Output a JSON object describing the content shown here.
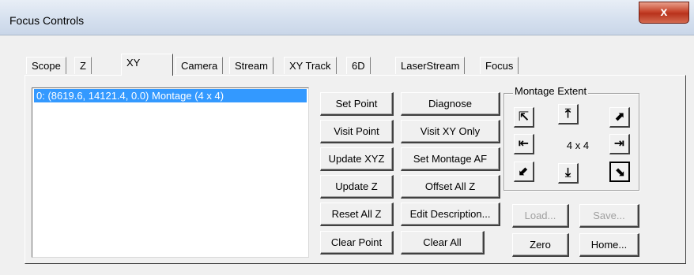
{
  "window": {
    "title": "Focus Controls",
    "close_glyph": "x"
  },
  "tabs": [
    {
      "label": "Scope"
    },
    {
      "label": "Z"
    },
    {
      "label": "XY"
    },
    {
      "label": "Camera"
    },
    {
      "label": "Stream"
    },
    {
      "label": "XY Track"
    },
    {
      "label": "6D"
    },
    {
      "label": "LaserStream"
    },
    {
      "label": "Focus"
    }
  ],
  "active_tab": "XY",
  "points_list": {
    "items": [
      {
        "text": "0: (8619.6, 14121.4, 0.0) Montage  (4 x 4)",
        "selected": true
      }
    ]
  },
  "buttons": {
    "set_point": "Set Point",
    "diagnose": "Diagnose",
    "visit_point": "Visit Point",
    "visit_xy_only": "Visit XY Only",
    "update_xyz": "Update XYZ",
    "set_montage_af": "Set Montage AF",
    "update_z": "Update Z",
    "offset_all_z": "Offset All Z",
    "reset_all_z": "Reset All Z",
    "edit_description": "Edit Description...",
    "clear_point": "Clear Point",
    "clear_all": "Clear All",
    "load": "Load...",
    "save": "Save...",
    "zero": "Zero",
    "home": "Home..."
  },
  "montage_extent": {
    "label": "Montage Extent",
    "value": "4 x 4",
    "arrows": {
      "up_left": "⇱",
      "up": "⤒",
      "up_right": "⇲",
      "left": "⇤",
      "right": "⇥",
      "down_left": "⇲",
      "down": "⤓",
      "down_right": "⇲"
    }
  }
}
